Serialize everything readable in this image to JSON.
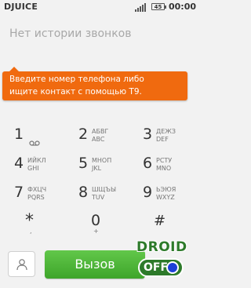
{
  "status": {
    "carrier": "DJUICE",
    "battery": "45",
    "time": "00:00"
  },
  "history": {
    "empty": "Нет истории звонков"
  },
  "tooltip": {
    "line1": "Введите номер телефона либо",
    "line2": "ищите контакт с помощью Т9."
  },
  "keys": [
    {
      "digit": "1",
      "letters1": "",
      "letters2": "voicemail-icon"
    },
    {
      "digit": "2",
      "letters1": "АБВГ",
      "letters2": "ABC"
    },
    {
      "digit": "3",
      "letters1": "ДЕЖЗ",
      "letters2": "DEF"
    },
    {
      "digit": "4",
      "letters1": "ИЙКЛ",
      "letters2": "GHI"
    },
    {
      "digit": "5",
      "letters1": "МНОП",
      "letters2": "JKL"
    },
    {
      "digit": "6",
      "letters1": "РСТУ",
      "letters2": "MNO"
    },
    {
      "digit": "7",
      "letters1": "ФХЦЧ",
      "letters2": "PQRS"
    },
    {
      "digit": "8",
      "letters1": "ШЩЪЫ",
      "letters2": "TUV"
    },
    {
      "digit": "9",
      "letters1": "ЬЭЮЯ",
      "letters2": "WXYZ"
    },
    {
      "digit": "*",
      "sub": ","
    },
    {
      "digit": "0",
      "sub": "+"
    },
    {
      "digit": "#",
      "sub": ""
    }
  ],
  "bottom": {
    "call_label": "Вызов",
    "contact_icon": "person-icon"
  },
  "watermark": {
    "top": "DROID",
    "bottom": "OFF"
  }
}
